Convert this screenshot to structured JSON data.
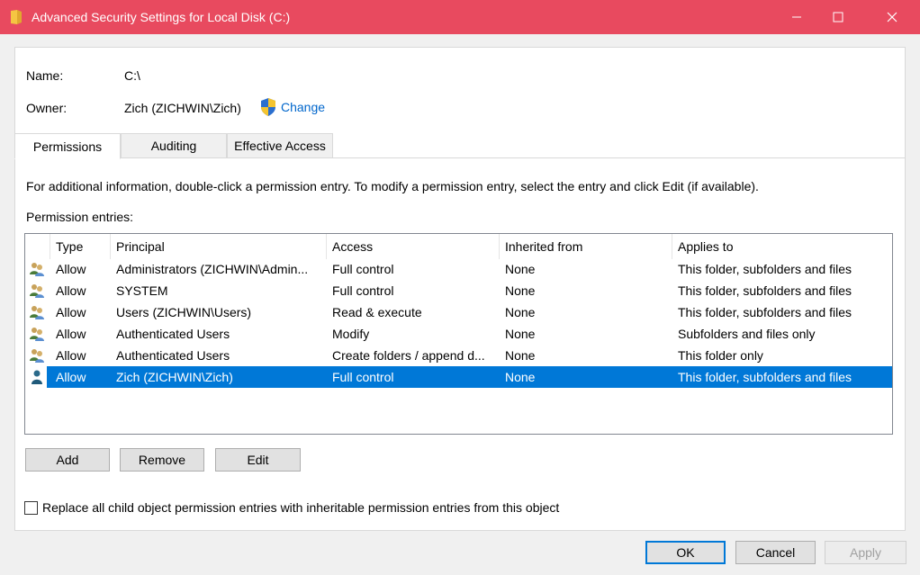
{
  "window": {
    "title": "Advanced Security Settings for Local Disk (C:)"
  },
  "info": {
    "name_label": "Name:",
    "name_value": "C:\\",
    "owner_label": "Owner:",
    "owner_value": "Zich (ZICHWIN\\Zich)",
    "change_link": "Change"
  },
  "tabs": [
    {
      "label": "Permissions",
      "active": true
    },
    {
      "label": "Auditing",
      "active": false
    },
    {
      "label": "Effective Access",
      "active": false
    }
  ],
  "permissions": {
    "instructions": "For additional information, double-click a permission entry. To modify a permission entry, select the entry and click Edit (if available).",
    "entries_label": "Permission entries:",
    "columns": [
      "Type",
      "Principal",
      "Access",
      "Inherited from",
      "Applies to"
    ],
    "rows": [
      {
        "icon": "group-icon",
        "type": "Allow",
        "principal": "Administrators (ZICHWIN\\Admin...",
        "access": "Full control",
        "inherited": "None",
        "applies": "This folder, subfolders and files",
        "selected": false
      },
      {
        "icon": "group-icon",
        "type": "Allow",
        "principal": "SYSTEM",
        "access": "Full control",
        "inherited": "None",
        "applies": "This folder, subfolders and files",
        "selected": false
      },
      {
        "icon": "group-icon",
        "type": "Allow",
        "principal": "Users (ZICHWIN\\Users)",
        "access": "Read & execute",
        "inherited": "None",
        "applies": "This folder, subfolders and files",
        "selected": false
      },
      {
        "icon": "group-icon",
        "type": "Allow",
        "principal": "Authenticated Users",
        "access": "Modify",
        "inherited": "None",
        "applies": "Subfolders and files only",
        "selected": false
      },
      {
        "icon": "group-icon",
        "type": "Allow",
        "principal": "Authenticated Users",
        "access": "Create folders / append d...",
        "inherited": "None",
        "applies": "This folder only",
        "selected": false
      },
      {
        "icon": "user-icon",
        "type": "Allow",
        "principal": "Zich (ZICHWIN\\Zich)",
        "access": "Full control",
        "inherited": "None",
        "applies": "This folder, subfolders and files",
        "selected": true
      }
    ],
    "add_label": "Add",
    "remove_label": "Remove",
    "edit_label": "Edit",
    "replace_checkbox_label": "Replace all child object permission entries with inheritable permission entries from this object",
    "replace_checked": false
  },
  "footer": {
    "ok_label": "OK",
    "cancel_label": "Cancel",
    "apply_label": "Apply"
  },
  "colors": {
    "titlebar": "#e84a5f",
    "selection": "#0078d7",
    "link": "#0066cc"
  }
}
